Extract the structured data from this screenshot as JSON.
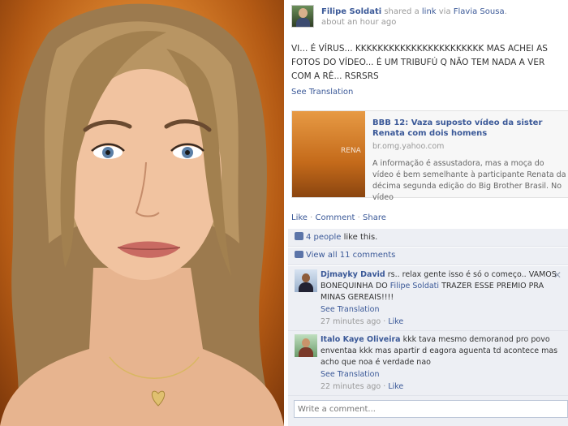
{
  "post": {
    "author": "Filipe Soldati",
    "shared_text": " shared a ",
    "link_word": "link",
    "via_text": " via ",
    "via_name": "Flavia Sousa",
    "period": ".",
    "time": "about an hour ago",
    "status": "VI... É VÍRUS... KKKKKKKKKKKKKKKKKKKKKKK MAS ACHEI AS FOTOS DO VÍDEO... É UM TRIBUFÚ Q NÃO TEM NADA A VER COM A RÊ... RSRSRS",
    "see_translation": "See Translation"
  },
  "share": {
    "title": "BBB 12: Vaza suposto vídeo da sister Renata com dois homens",
    "domain": "br.omg.yahoo.com",
    "description": "A informação é assustadora, mas a moça do vídeo é bem semelhante à participante Renata da décima segunda edição do Big Brother Brasil. No vídeo",
    "thumb_text": "RENA"
  },
  "actions": {
    "like": "Like",
    "comment": "Comment",
    "share": "Share",
    "sep": " · "
  },
  "likes": {
    "count_text": "4 people",
    "suffix": " like this."
  },
  "view_all": "View all 11 comments",
  "comments": [
    {
      "name": "Djmayky David",
      "text_a": " rs.. relax gente isso é só o começo.. VAMOS BONEQUINHA DO ",
      "mention": "Filipe Soldati",
      "text_b": " TRAZER ESSE PREMIO PRA MINAS GEREAIS!!!!",
      "see_translation": "See Translation",
      "time": "27 minutes ago",
      "like": "Like"
    },
    {
      "name": "Italo Kaye Oliveira",
      "text": " kkk tava mesmo demoranod pro povo enventaa kkk mas apartir d eagora aguenta td acontece mas acho que noa é verdade nao",
      "see_translation": "See Translation",
      "time": "22 minutes ago",
      "like": "Like"
    }
  ],
  "write_comment_placeholder": "Write a comment...",
  "icons": {
    "close": "close-icon",
    "like": "thumbs-up-icon",
    "comments": "comment-icon"
  },
  "colors": {
    "link": "#3b5998",
    "ufi_bg": "#edeff4",
    "photo_bg": "#e08a32"
  }
}
